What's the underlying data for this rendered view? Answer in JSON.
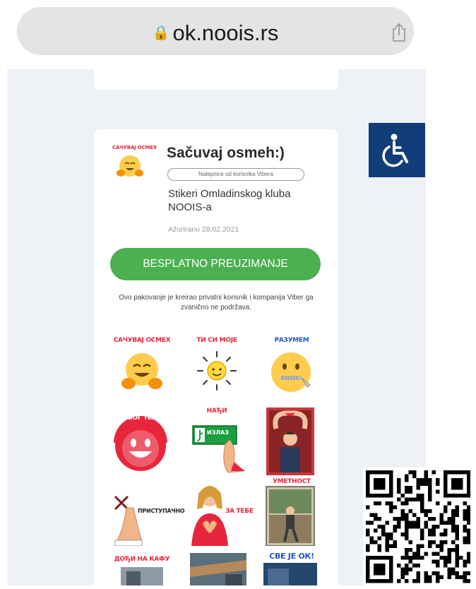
{
  "browser": {
    "url": "ok.noois.rs"
  },
  "pack": {
    "title": "Sačuvaj osmeh:)",
    "tag": "Nalepnice od korisnika Vibera",
    "description": "Stikeri Omladinskog kluba NOOIS-a",
    "updated": "Ažurirano 28.02.2021",
    "download_label": "BESPLATNO PREUZIMANJE",
    "disclaimer": "Ovo pakovanje je kreirao privatni korisnik i kompanija Viber ga zvanično ne podržava.",
    "icon_caption": "САЧУВАЈ ОСМЕХ"
  },
  "stickers": [
    {
      "caption": "САЧУВАЈ ОСМЕХ",
      "icon": "hugging-face-icon"
    },
    {
      "caption": "ТИ СИ МОЈЕ",
      "icon": "sun-icon"
    },
    {
      "caption": "РАЗУМЕМ",
      "icon": "zipper-mouth-face-icon"
    },
    {
      "caption": "ЗБОГ ТЕБЕ",
      "icon": "smiling-face-icon"
    },
    {
      "caption": "НАЂИ",
      "icon": "exit-sign-icon",
      "sign_text": "ИЗЛАЗ"
    },
    {
      "caption": "",
      "icon": "heart-hands-photo-icon"
    },
    {
      "caption": "ПРИСТУПАЧНО",
      "icon": "hand-gesture-icon"
    },
    {
      "caption": "ЗА ТЕБЕ",
      "icon": "heart-hands-girl-icon"
    },
    {
      "caption": "УМЕТНОСТ",
      "icon": "art-photo-icon"
    },
    {
      "caption": "ДОЂИ НА КАФУ",
      "icon": "coffee-photo-icon"
    },
    {
      "caption": "",
      "icon": "room-photo-icon"
    },
    {
      "caption": "СВЕ ЈЕ ОК!",
      "icon": "ok-photo-icon"
    }
  ],
  "colors": {
    "download_button": "#4caf50",
    "accessibility_button": "#113e79",
    "sticker_caption": "#e8263b"
  }
}
